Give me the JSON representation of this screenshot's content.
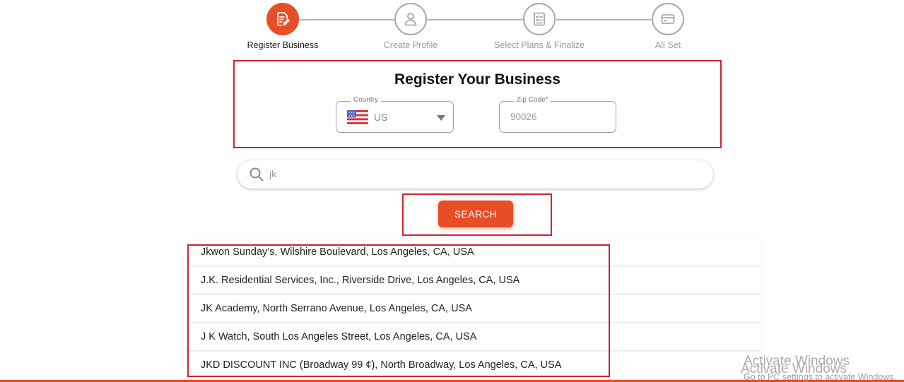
{
  "stepper": {
    "steps": [
      {
        "label": "Register Business",
        "icon": "document-edit-icon",
        "active": true
      },
      {
        "label": "Create Profile",
        "icon": "user-icon",
        "active": false
      },
      {
        "label": "Select Plans & Finalize",
        "icon": "checklist-icon",
        "active": false
      },
      {
        "label": "All Set",
        "icon": "credit-card-icon",
        "active": false
      }
    ]
  },
  "register": {
    "title": "Register Your Business",
    "country_label": "Country",
    "country_value": "US",
    "country_flag": "us-flag-icon",
    "zip_label": "Zip Code*",
    "zip_value": "90026"
  },
  "search": {
    "value": "jk",
    "button_label": "SEARCH"
  },
  "results": [
    "Jkwon Sunday’s, Wilshire Boulevard, Los Angeles, CA, USA",
    "J.K. Residential Services, Inc., Riverside Drive, Los Angeles, CA, USA",
    "JK Academy, North Serrano Avenue, Los Angeles, CA, USA",
    "J K Watch, South Los Angeles Street, Los Angeles, CA, USA",
    "JKD DISCOUNT INC (Broadway 99 ¢), North Broadway, Los Angeles, CA, USA"
  ],
  "watermark": {
    "line1": "Activate Windows",
    "line2": "Activate Windows",
    "line3": "Go to PC settings to activate Windows."
  },
  "colors": {
    "accent": "#e84e26",
    "highlight_border": "#d2232a",
    "inactive": "#a8a8a8"
  }
}
